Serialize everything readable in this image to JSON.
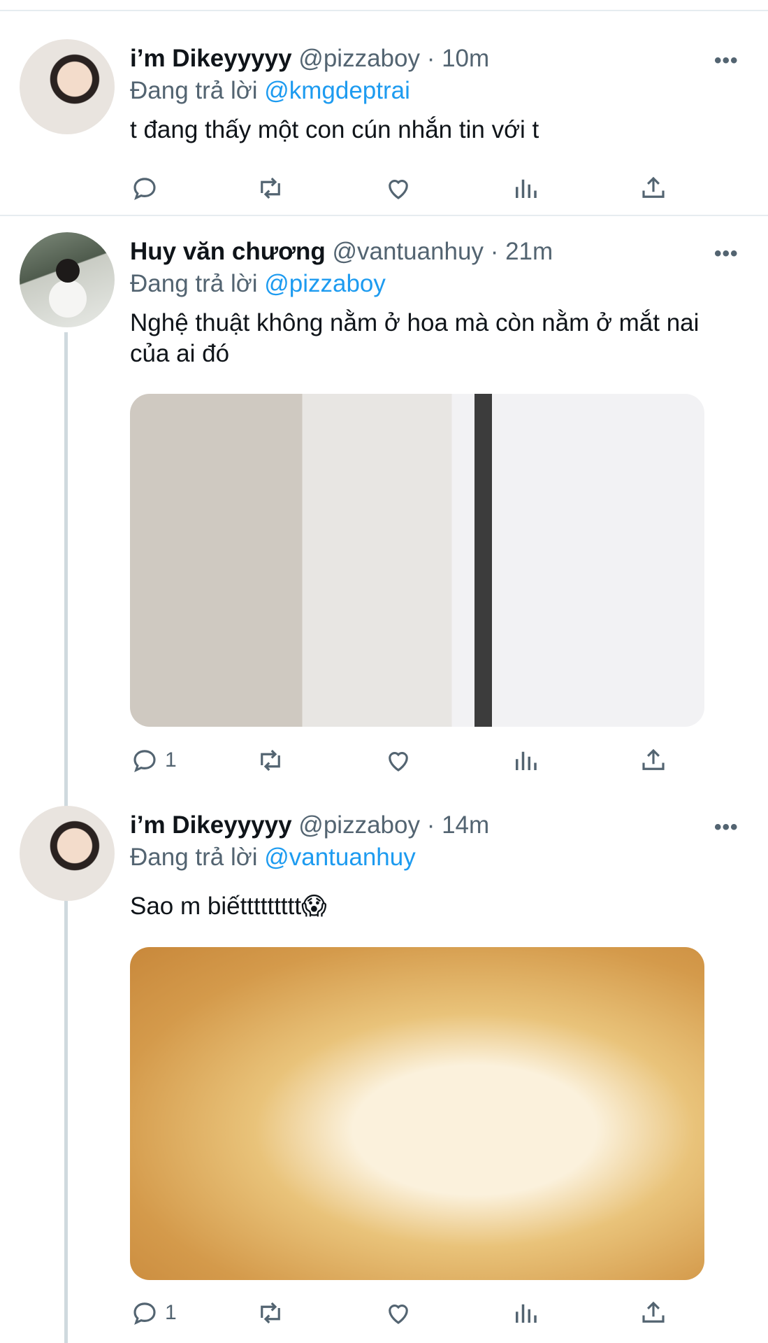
{
  "tweets": [
    {
      "name": "i’m Dikeyyyyy",
      "handle": "@pizzaboy",
      "dot": "·",
      "time": "10m",
      "reply_prefix": "Đang trả lời",
      "reply_to": "@kmgdeptrai",
      "text": "t đang thấy một con cún nhắn tin với t",
      "reply_count": ""
    },
    {
      "name": "Huy văn chương",
      "handle": "@vantuanhuy",
      "dot": "·",
      "time": "21m",
      "reply_prefix": "Đang trả lời",
      "reply_to": "@pizzaboy",
      "text": "Nghệ thuật không nằm ở hoa mà còn nằm ở mắt nai của ai đó",
      "reply_count": "1"
    },
    {
      "name": "i’m Dikeyyyyy",
      "handle": "@pizzaboy",
      "dot": "·",
      "time": "14m",
      "reply_prefix": "Đang trả lời",
      "reply_to": "@vantuanhuy",
      "text": "Sao m biếttttttttt😱",
      "reply_count": "1"
    }
  ],
  "icons": {
    "more": "more-icon",
    "reply": "reply-icon",
    "retweet": "retweet-icon",
    "like": "heart-icon",
    "views": "views-icon",
    "share": "share-icon"
  },
  "colors": {
    "link": "#1d9bf0",
    "secondary": "#536471",
    "divider": "#e6ecf0"
  }
}
